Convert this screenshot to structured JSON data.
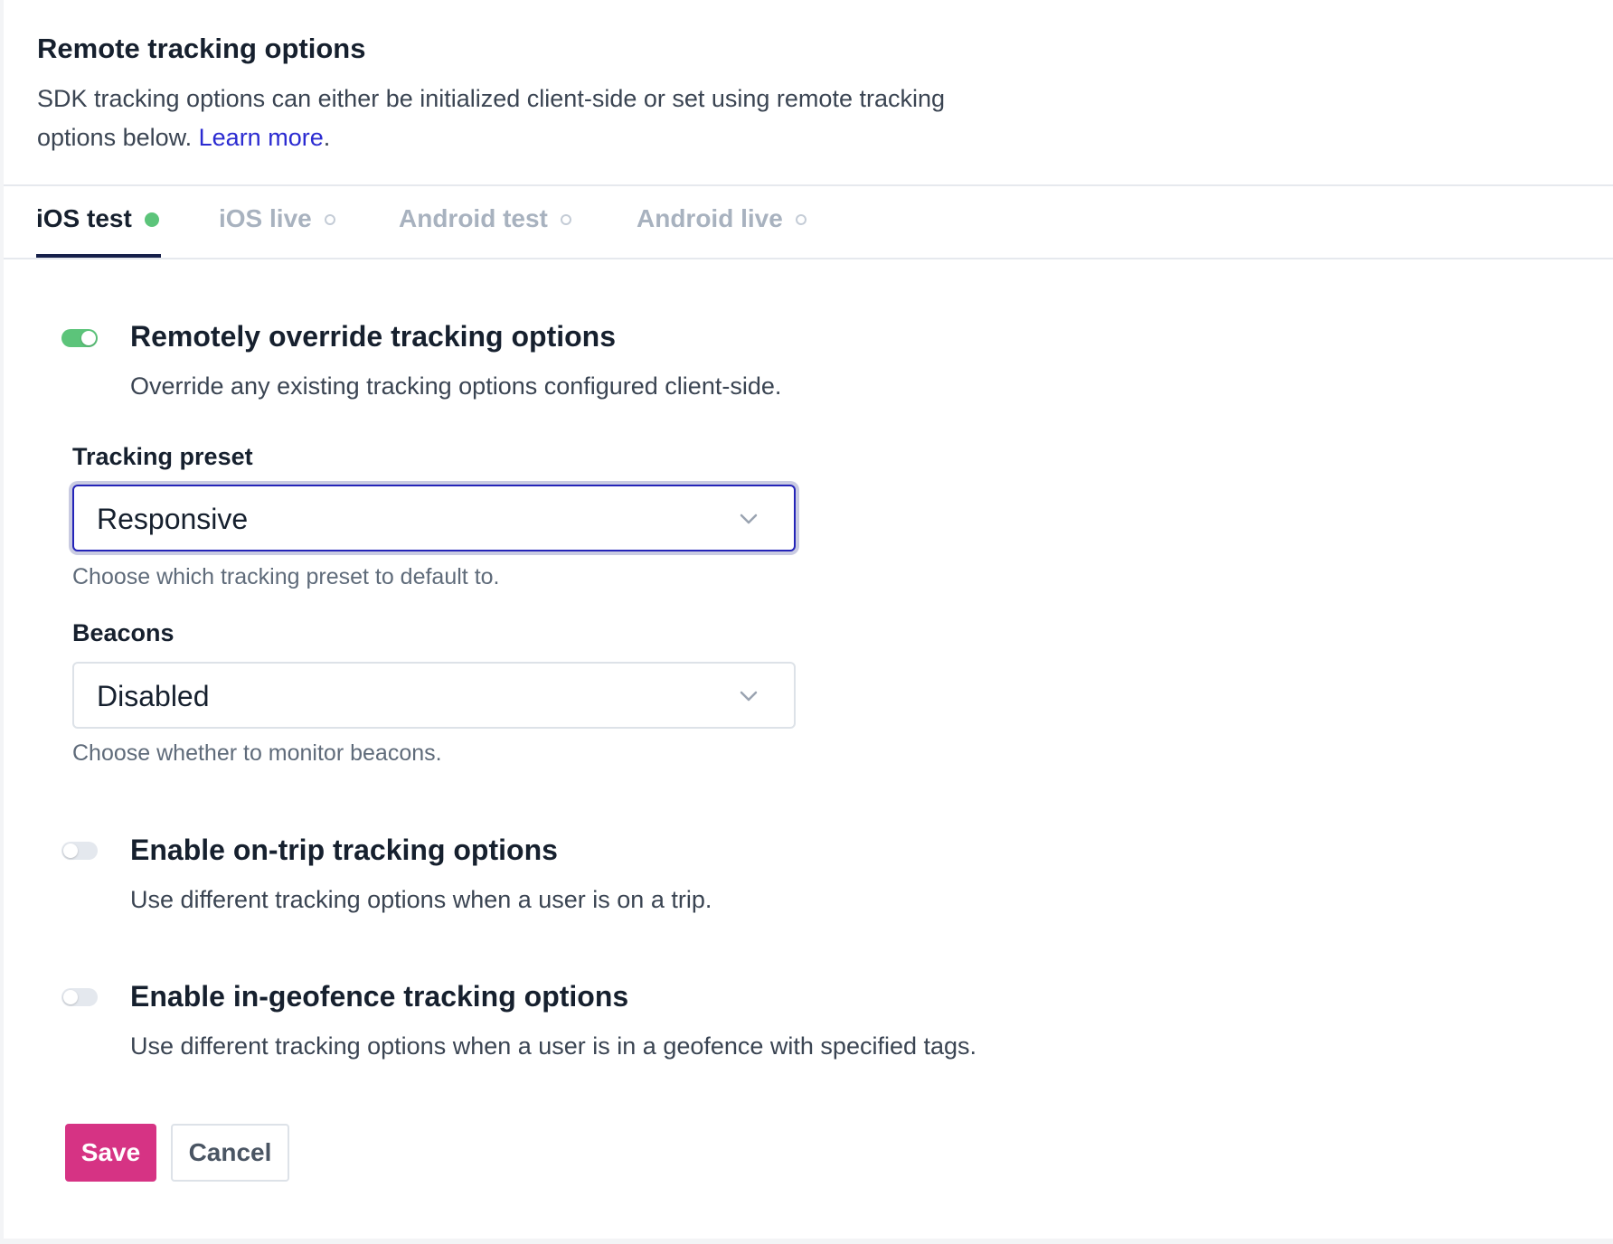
{
  "header": {
    "title": "Remote tracking options",
    "description": "SDK tracking options can either be initialized client-side or set using remote tracking options below.",
    "learn_more": "Learn more",
    "learn_more_suffix": "."
  },
  "tabs": [
    {
      "label": "iOS test",
      "active": true,
      "status": "active"
    },
    {
      "label": "iOS live",
      "active": false,
      "status": "inactive"
    },
    {
      "label": "Android test",
      "active": false,
      "status": "inactive"
    },
    {
      "label": "Android live",
      "active": false,
      "status": "inactive"
    }
  ],
  "override": {
    "enabled": true,
    "title": "Remotely override tracking options",
    "description": "Override any existing tracking options configured client-side."
  },
  "tracking_preset": {
    "label": "Tracking preset",
    "value": "Responsive",
    "help": "Choose which tracking preset to default to."
  },
  "beacons": {
    "label": "Beacons",
    "value": "Disabled",
    "help": "Choose whether to monitor beacons."
  },
  "on_trip": {
    "enabled": false,
    "title": "Enable on-trip tracking options",
    "description": "Use different tracking options when a user is on a trip."
  },
  "in_geofence": {
    "enabled": false,
    "title": "Enable in-geofence tracking options",
    "description": "Use different tracking options when a user is in a geofence with specified tags."
  },
  "actions": {
    "save_label": "Save",
    "cancel_label": "Cancel"
  },
  "colors": {
    "accent_green": "#5cc47a",
    "save_button": "#d63384",
    "link": "#2b2bd1",
    "focus_border": "#2424b8"
  }
}
